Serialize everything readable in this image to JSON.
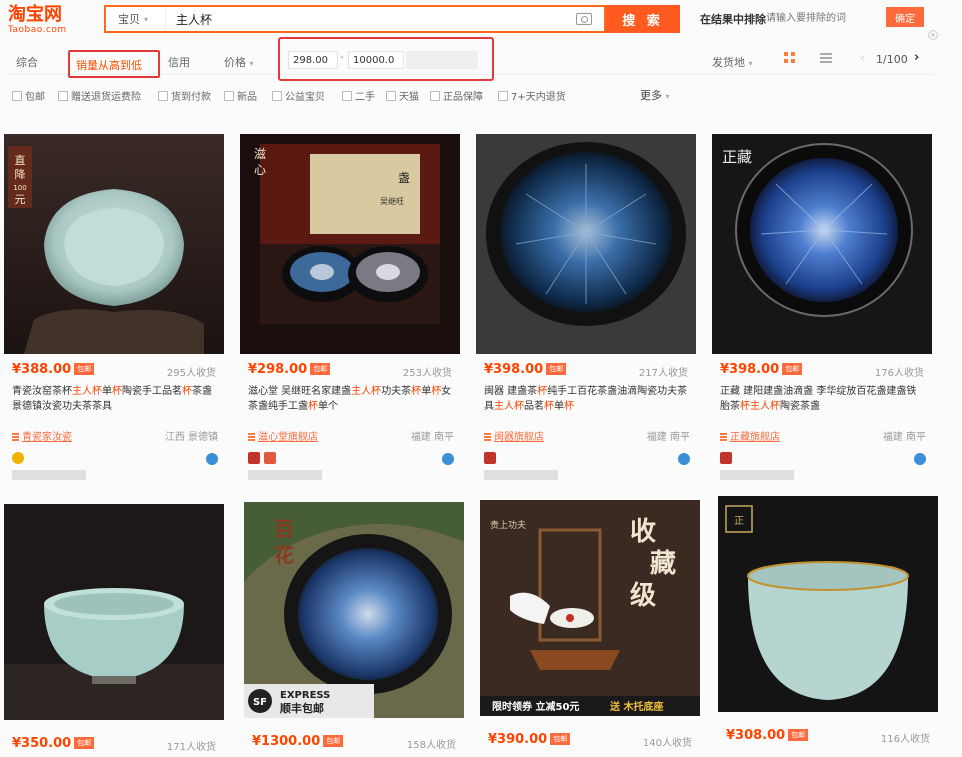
{
  "brand": {
    "logo_cn": "淘宝网",
    "logo_en": "Taobao.com",
    "color": "#ff4400"
  },
  "search": {
    "category": "宝贝",
    "query": "主人杯",
    "button": "搜 索",
    "in_result_label": "在结果中排除",
    "exclude_placeholder": "请输入要排除的词",
    "confirm": "确定"
  },
  "sortbar": {
    "items": [
      "综合",
      "销量从高到低",
      "信用",
      "价格"
    ],
    "price_min": "298.00",
    "price_dash": "-",
    "price_max": "10000.0",
    "ship_from": "发货地",
    "page": "1/100",
    "prev": "‹",
    "next": "›"
  },
  "filters": {
    "items": [
      "包邮",
      "赠送退货运费险",
      "货到付款",
      "新品",
      "公益宝贝",
      "二手",
      "天猫",
      "正品保障",
      "7+天内退货"
    ],
    "more": "更多"
  },
  "products": [
    {
      "price": "¥388.00",
      "badge": "包邮",
      "sales": "295人收货",
      "title": "青瓷汝窑茶杯主人杯单杯陶瓷手工品茗杯茶盏景德镇汝瓷功夫茶茶具",
      "shop": "青瓷家汝瓷",
      "location": "江西 景德镇"
    },
    {
      "price": "¥298.00",
      "badge": "包邮",
      "sales": "253人收货",
      "title": "滋心堂 吴继旺名家建盏主人杯功夫茶杯单杯女茶盏纯手工盏杯单个",
      "shop": "滋心堂旗舰店",
      "location": "福建 南平"
    },
    {
      "price": "¥398.00",
      "badge": "包邮",
      "sales": "217人收货",
      "title": "闽器 建盏茶杯纯手工百花茶盏油滴陶瓷功夫茶具主人杯品茗杯单杯",
      "shop": "闽器旗舰店",
      "location": "福建 南平"
    },
    {
      "price": "¥398.00",
      "badge": "包邮",
      "sales": "176人收货",
      "title": "正藏 建阳建盏油滴盏 李华绽放百花盏建盏铁胎茶杯主人杯陶瓷茶盏",
      "shop": "正藏旗舰店",
      "location": "福建 南平"
    }
  ],
  "products_row2": [
    {
      "price": "¥350.00",
      "badge": "包邮",
      "sales": "171人收货"
    },
    {
      "price": "¥1300.00",
      "badge": "包邮",
      "sales": "158人收货",
      "image_text": {
        "label": "百花",
        "express": "EXPRESS",
        "express_cn": "顺丰包邮"
      }
    },
    {
      "price": "¥390.00",
      "badge": "包邮",
      "sales": "140人收货",
      "image_text": {
        "brand": "贵上功夫",
        "big": "收藏级",
        "promo": "限时领券 立减50元",
        "promo2": "送 木托底座"
      }
    },
    {
      "price": "¥308.00",
      "badge": "包邮",
      "sales": "116人收货"
    }
  ],
  "overlay_text": {
    "p1_corner": "直降100元",
    "p2_corner": "滋心",
    "p4_corner": "正藏"
  }
}
